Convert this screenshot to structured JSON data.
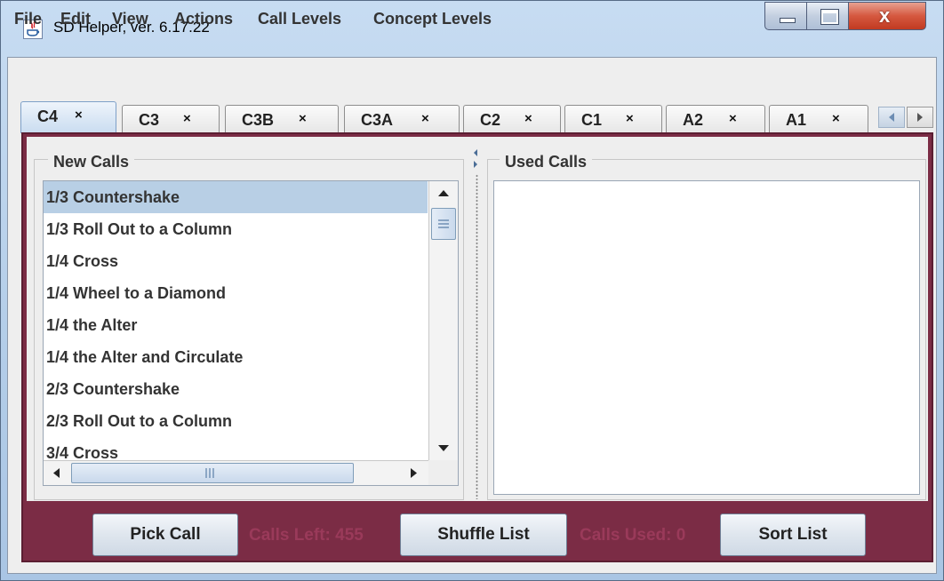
{
  "window": {
    "title": "SD Helper, ver. 6.17.22"
  },
  "menu": [
    "File",
    "Edit",
    "View",
    "Actions",
    "Call Levels",
    "Concept Levels"
  ],
  "tabs": [
    {
      "label": "C4",
      "close": "×"
    },
    {
      "label": "C3",
      "close": "×"
    },
    {
      "label": "C3B",
      "close": "×"
    },
    {
      "label": "C3A",
      "close": "×"
    },
    {
      "label": "C2",
      "close": "×"
    },
    {
      "label": "C1",
      "close": "×"
    },
    {
      "label": "A2",
      "close": "×"
    },
    {
      "label": "A1",
      "close": "×"
    }
  ],
  "selected_tab": "C4",
  "new_calls": {
    "title": "New Calls",
    "items": [
      "1/3 Countershake",
      "1/3 Roll Out to a Column",
      "1/4 Cross",
      "1/4 Wheel to a Diamond",
      "1/4 the Alter",
      "1/4 the Alter and Circulate",
      "2/3 Countershake",
      "2/3 Roll Out to a Column",
      "3/4 Cross"
    ],
    "selected_index": 0
  },
  "used_calls": {
    "title": "Used Calls",
    "items": []
  },
  "bottom": {
    "pick_label": "Pick Call",
    "calls_left": "Calls Left: 455",
    "shuffle_label": "Shuffle List",
    "calls_used": "Calls Used: 0",
    "sort_label": "Sort List"
  },
  "colors": {
    "panel": "#7b2c45",
    "selection": "#b8cfe5",
    "status_text": "#9a3a5a",
    "close_button": "#d5583f"
  },
  "icons": [
    "java-app-icon",
    "minimize-icon",
    "maximize-icon",
    "close-icon",
    "tab-close-icon",
    "scroll-up-arrow-icon",
    "scroll-down-arrow-icon",
    "scroll-left-arrow-icon",
    "scroll-right-arrow-icon"
  ]
}
